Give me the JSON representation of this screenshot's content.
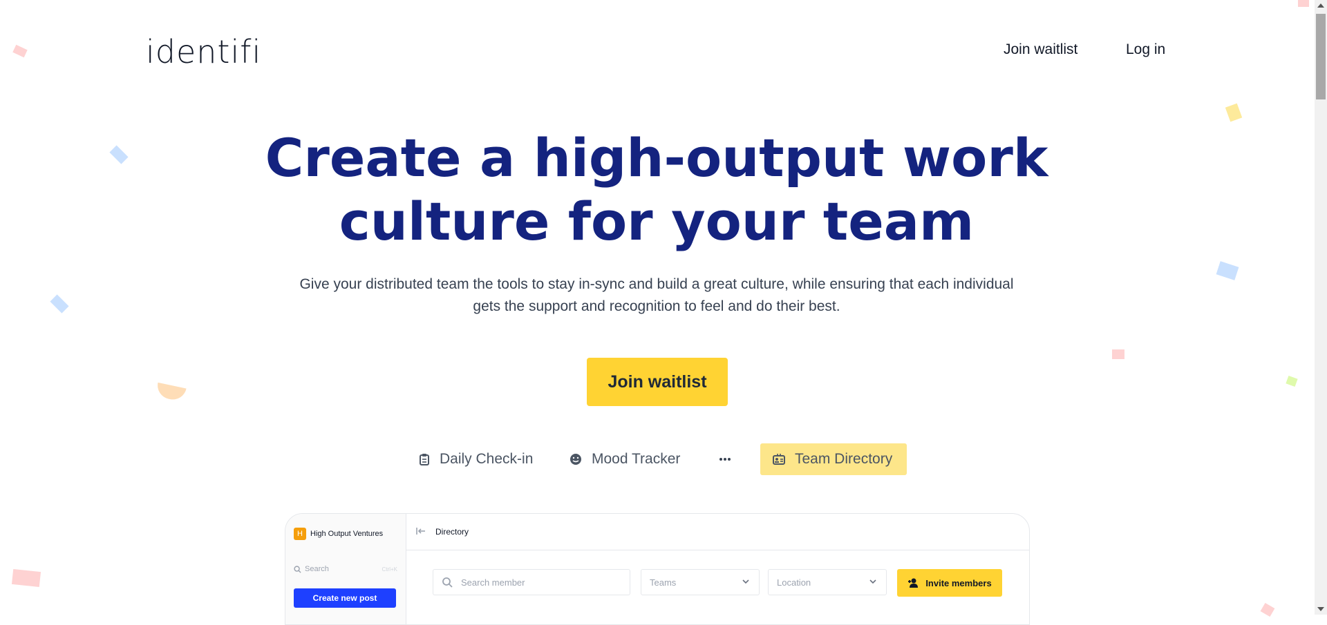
{
  "header": {
    "logo_text": "identifi",
    "nav": {
      "join_waitlist": "Join waitlist",
      "log_in": "Log in"
    }
  },
  "hero": {
    "title_line1": "Create a high-output work",
    "title_line2": "culture for your team",
    "subtitle_line1": "Give your distributed team the tools to stay in-sync and build a great culture, while ensuring that each individual",
    "subtitle_line2": "gets the support and recognition to feel and do their best.",
    "cta_label": "Join waitlist"
  },
  "features": {
    "tabs": [
      {
        "label": "Daily Check-in",
        "icon": "clipboard-icon",
        "active": false
      },
      {
        "label": "Mood Tracker",
        "icon": "smile-icon",
        "active": false
      },
      {
        "label": "",
        "icon": "more-icon",
        "active": false
      },
      {
        "label": "Team Directory",
        "icon": "id-card-icon",
        "active": true
      }
    ]
  },
  "app_preview": {
    "org_initial": "H",
    "org_name": "High Output Ventures",
    "search_label": "Search",
    "search_shortcut": "Ctrl+K",
    "new_post_label": "Create new post",
    "breadcrumb": "Directory",
    "search_member_placeholder": "Search member",
    "teams_label": "Teams",
    "location_label": "Location",
    "invite_label": "Invite members"
  },
  "colors": {
    "title": "#14237f",
    "accent_yellow": "#ffd333",
    "active_tab_bg": "#fde68a",
    "primary_blue": "#1e40ff"
  }
}
